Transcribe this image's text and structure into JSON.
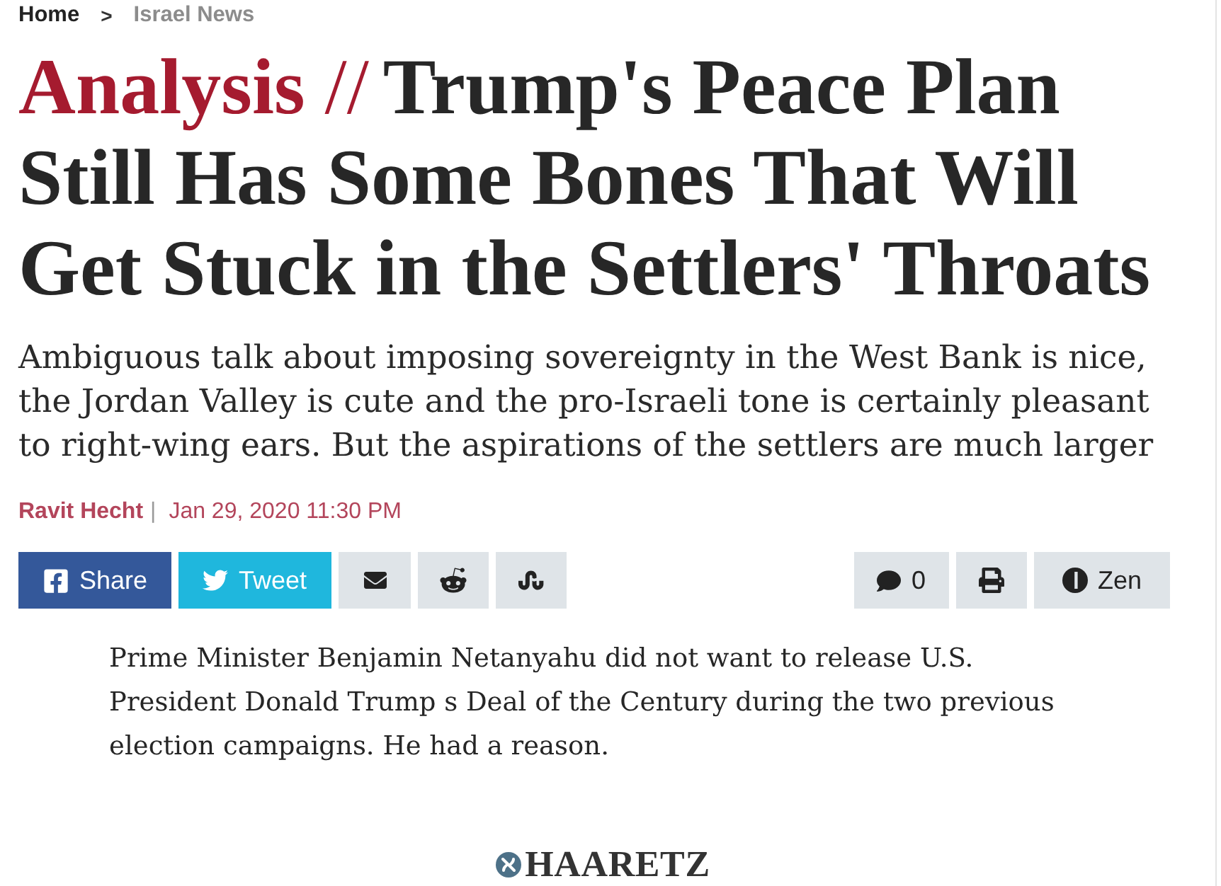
{
  "breadcrumb": {
    "separator": ">",
    "items": [
      {
        "label": "Home",
        "current": false
      },
      {
        "label": "Israel News",
        "current": true
      }
    ]
  },
  "headline": {
    "label": "Analysis",
    "divider": "//",
    "title": "Trump's Peace Plan Still Has Some Bones That Will Get Stuck in the Settlers' Throats"
  },
  "subtitle": "Ambiguous talk about imposing sovereignty in the West Bank is nice, the Jordan Valley is cute and the pro-Israeli tone is certainly pleasant to right-wing ears. But the aspirations of the settlers are much larger",
  "byline": {
    "author": "Ravit Hecht",
    "separator": "|",
    "date": "Jan 29, 2020 11:30 PM"
  },
  "share_buttons": [
    {
      "kind": "facebook",
      "label": "Share"
    },
    {
      "kind": "twitter",
      "label": "Tweet"
    },
    {
      "kind": "email"
    },
    {
      "kind": "reddit"
    },
    {
      "kind": "stumbleupon"
    }
  ],
  "tools": [
    {
      "kind": "comments",
      "label": "0"
    },
    {
      "kind": "print"
    },
    {
      "kind": "zen",
      "label": "Zen"
    }
  ],
  "body": "Prime Minister Benjamin Netanyahu did not want to release U.S. President Donald Trump s Deal of the Century during the two previous election campaigns. He had a reason.",
  "logo": {
    "text": "HAARETZ"
  }
}
